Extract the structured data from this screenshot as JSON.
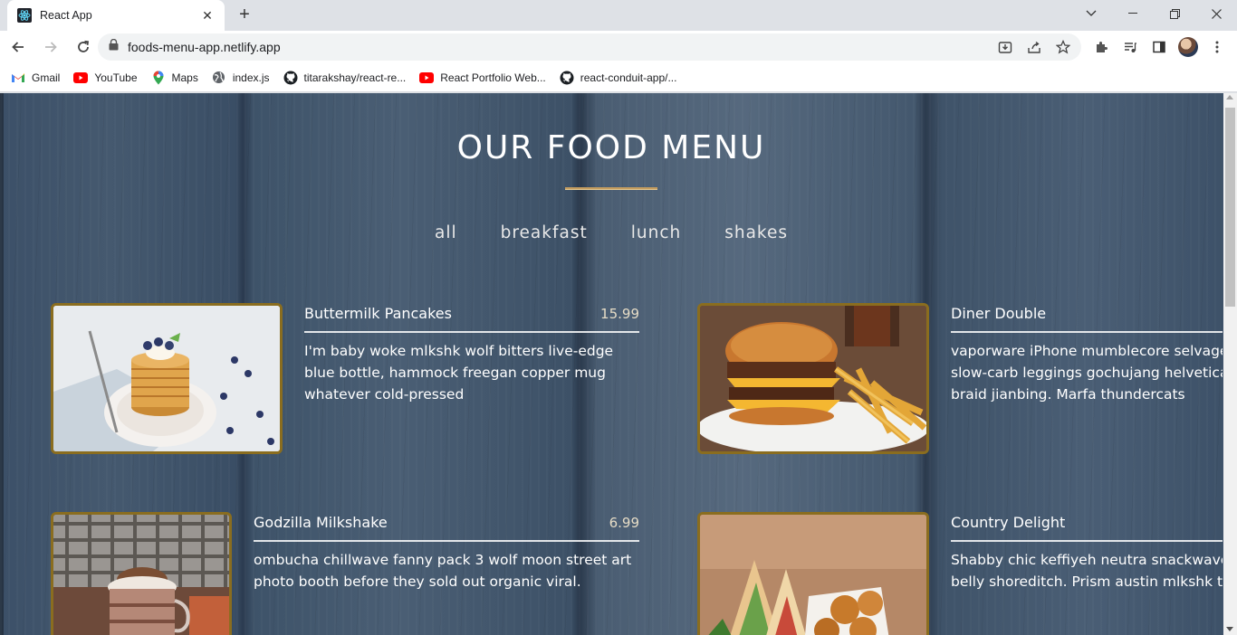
{
  "browser": {
    "tab_title": "React App",
    "url": "foods-menu-app.netlify.app",
    "bookmarks": [
      {
        "label": "Gmail",
        "icon": "gmail-icon"
      },
      {
        "label": "YouTube",
        "icon": "youtube-icon"
      },
      {
        "label": "Maps",
        "icon": "maps-icon"
      },
      {
        "label": "index.js",
        "icon": "globe-icon"
      },
      {
        "label": "titarakshay/react-re...",
        "icon": "github-icon"
      },
      {
        "label": "React Portfolio Web...",
        "icon": "youtube-icon"
      },
      {
        "label": "react-conduit-app/...",
        "icon": "github-icon"
      }
    ]
  },
  "page": {
    "title": "OUR FOOD MENU",
    "accent_color": "#c59d5f",
    "filters": [
      "all",
      "breakfast",
      "lunch",
      "shakes"
    ],
    "items": [
      {
        "name": "Buttermilk Pancakes",
        "price": "15.99",
        "desc": "I'm baby woke mlkshk wolf bitters live-edge blue bottle, hammock freegan copper mug whatever cold-pressed",
        "image": "pancakes-photo"
      },
      {
        "name": "Diner Double",
        "price": "",
        "desc": "vaporware iPhone mumblecore selvage denim slow-carb leggings gochujang helvetica man braid jianbing. Marfa thundercats",
        "image": "burger-photo"
      },
      {
        "name": "Godzilla Milkshake",
        "price": "6.99",
        "desc": "ombucha chillwave fanny pack 3 wolf moon street art photo booth before they sold out organic viral.",
        "image": "milkshake-photo"
      },
      {
        "name": "Country Delight",
        "price": "",
        "desc": "Shabby chic keffiyeh neutra snackwave pork belly shoreditch. Prism austin mlkshk truffaut,",
        "image": "sandwich-photo"
      }
    ]
  }
}
